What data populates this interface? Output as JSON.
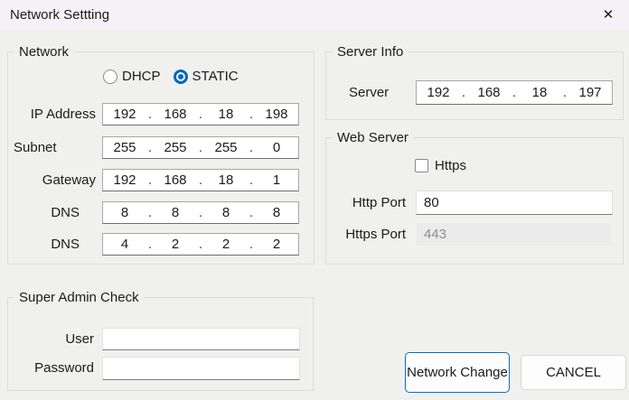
{
  "window": {
    "title": "Network Settting",
    "close_icon": "✕"
  },
  "sep": {
    "dot": "."
  },
  "network_group": {
    "label": "Network",
    "radio": {
      "dhcp_label": "DHCP",
      "static_label": "STATIC",
      "selected": "STATIC"
    },
    "rows": [
      {
        "label": "IP Address",
        "octets": [
          "192",
          "168",
          "18",
          "198"
        ]
      },
      {
        "label": "Subnet",
        "octets": [
          "255",
          "255",
          "255",
          "0"
        ]
      },
      {
        "label": "Gateway",
        "octets": [
          "192",
          "168",
          "18",
          "1"
        ]
      },
      {
        "label": "DNS",
        "octets": [
          "8",
          "8",
          "8",
          "8"
        ]
      },
      {
        "label": "DNS",
        "octets": [
          "4",
          "2",
          "2",
          "2"
        ]
      }
    ]
  },
  "server_info_group": {
    "label": "Server Info",
    "server_label": "Server",
    "octets": [
      "192",
      "168",
      "18",
      "197"
    ]
  },
  "web_server_group": {
    "label": "Web Server",
    "https_checkbox_label": "Https",
    "https_checked": false,
    "http_port_label": "Http Port",
    "http_port_value": "80",
    "https_port_label": "Https Port",
    "https_port_value": "443",
    "https_port_disabled": true
  },
  "super_admin_group": {
    "label": "Super Admin Check",
    "user_label": "User",
    "user_value": "",
    "password_label": "Password",
    "password_value": ""
  },
  "buttons": {
    "network_change_label": "Network Change",
    "cancel_label": "CANCEL"
  },
  "colors": {
    "accent": "#0067c0",
    "dialog_bg": "#f0f0ef",
    "titlebar_bg": "#f6f1f7",
    "group_border": "#dcdcdc",
    "disabled_text": "#8d8d8d"
  }
}
